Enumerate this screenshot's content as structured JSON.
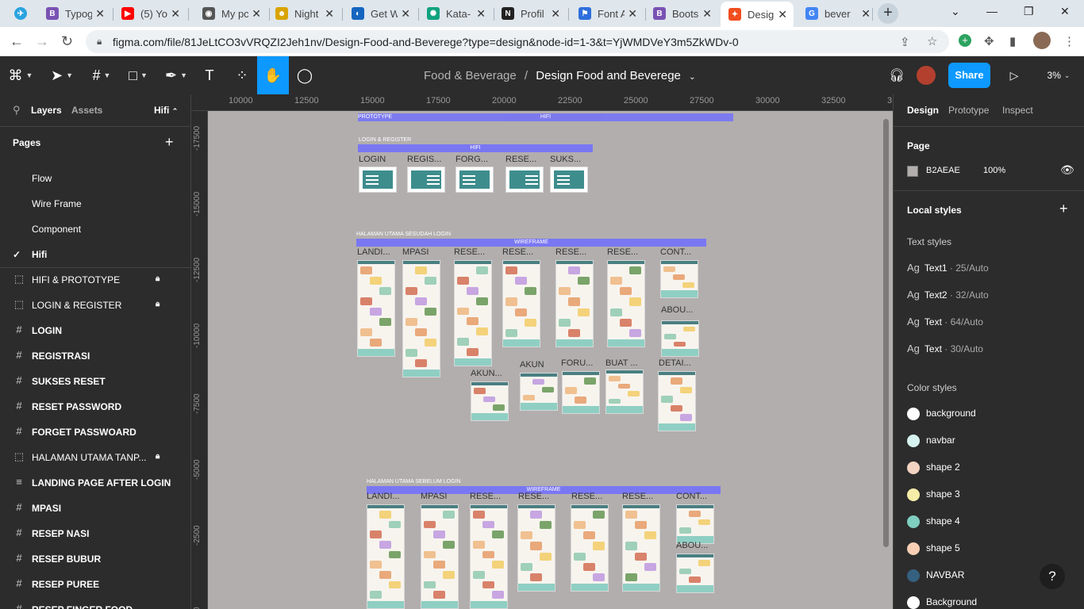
{
  "browser": {
    "tabs": [
      {
        "label": "Typog",
        "icon": "bootstrap-icon",
        "color": "#7952b3"
      },
      {
        "label": "(5) Yo",
        "icon": "youtube-icon",
        "color": "#ff0000"
      },
      {
        "label": "My pc",
        "icon": "globe-icon",
        "color": "#555555"
      },
      {
        "label": "Night",
        "icon": "mask-icon",
        "color": "#d9a400"
      },
      {
        "label": "Get W",
        "icon": "edge-icon",
        "color": "#1565c0"
      },
      {
        "label": "Kata-",
        "icon": "chatgpt-icon",
        "color": "#10a37f"
      },
      {
        "label": "Profil",
        "icon": "notion-icon",
        "color": "#222222"
      },
      {
        "label": "Font A",
        "icon": "flag-icon",
        "color": "#2f6fdd"
      },
      {
        "label": "Boots",
        "icon": "bootstrap-icon",
        "color": "#7952b3"
      },
      {
        "label": "Desig",
        "icon": "figma-icon",
        "color": "#f24e1e"
      },
      {
        "label": "bever",
        "icon": "google-icon",
        "color": "#4285f4"
      }
    ],
    "url": "figma.com/file/81JeLtCO3vVRQZI2Jeh1nv/Design-Food-and-Beverege?type=design&node-id=1-3&t=YjWMDVeY3m5ZkWDv-0"
  },
  "figma": {
    "project": "Food & Beverage",
    "separator": "/",
    "file": "Design Food and Beverege",
    "share": "Share",
    "zoom": "3%"
  },
  "left": {
    "tab_layers": "Layers",
    "tab_assets": "Assets",
    "page_switch": "Hifi",
    "pages_heading": "Pages",
    "pages": [
      "Flow",
      "Wire Frame",
      "Component",
      "Hifi"
    ],
    "current_page_check": "✓",
    "layers": [
      {
        "label": "HIFI & PROTOTYPE",
        "icon": "section-icon",
        "locked": true
      },
      {
        "label": "LOGIN & REGISTER",
        "icon": "section-icon",
        "locked": true
      },
      {
        "label": "LOGIN",
        "icon": "frame-icon",
        "locked": false
      },
      {
        "label": "REGISTRASI",
        "icon": "frame-icon",
        "locked": false
      },
      {
        "label": "SUKSES RESET",
        "icon": "frame-icon",
        "locked": false
      },
      {
        "label": "RESET PASSWORD",
        "icon": "frame-icon",
        "locked": false
      },
      {
        "label": "FORGET PASSWOARD",
        "icon": "frame-icon",
        "locked": false
      },
      {
        "label": "HALAMAN UTAMA TANP...",
        "icon": "section-icon",
        "locked": true
      },
      {
        "label": "LANDING PAGE AFTER LOGIN",
        "icon": "autolayout-icon",
        "locked": false
      },
      {
        "label": "MPASI",
        "icon": "frame-icon",
        "locked": false
      },
      {
        "label": "RESEP NASI",
        "icon": "frame-icon",
        "locked": false
      },
      {
        "label": "RESEP BUBUR",
        "icon": "frame-icon",
        "locked": false
      },
      {
        "label": "RESEP PUREE",
        "icon": "frame-icon",
        "locked": false
      },
      {
        "label": "RESEP FINGER FOOD",
        "icon": "frame-icon",
        "locked": false
      }
    ]
  },
  "rulers": {
    "top": [
      "10000",
      "12500",
      "15000",
      "17500",
      "20000",
      "22500",
      "25000",
      "27500",
      "30000",
      "32500",
      "3"
    ],
    "left": [
      "-17500",
      "-15000",
      "-12500",
      "-10000",
      "-7500",
      "-5000",
      "-2500",
      "0"
    ]
  },
  "canvas": {
    "bg": "#B2AEAE",
    "top_section": "PROTOTYPE",
    "top_bar": "HIFI",
    "login_section": "LOGIN & REGISTER",
    "login_bar": "HIFI",
    "login_frames": [
      "LOGIN",
      "REGIS...",
      "FORG...",
      "RESE...",
      "SUKS..."
    ],
    "after_section": "HALAMAN UTAMA SESUDAH LOGIN",
    "after_bar": "WIREFRAME",
    "after_frames_row1": [
      "LANDI...",
      "MPASI",
      "RESE...",
      "RESE...",
      "RESE...",
      "RESE...",
      "CONT..."
    ],
    "after_frames_row2": [
      "AKUN...",
      "AKUN",
      "FORU...",
      "BUAT ...",
      "DETAI...",
      "ABOU..."
    ],
    "before_section": "HALAMAN UTAMA SEBELUM LOGIN",
    "before_bar": "WIREFRAME",
    "before_frames": [
      "LANDI...",
      "MPASI",
      "RESE...",
      "RESE...",
      "RESE...",
      "RESE...",
      "CONT...",
      "ABOU..."
    ]
  },
  "right": {
    "tab_design": "Design",
    "tab_prototype": "Prototype",
    "tab_inspect": "Inspect",
    "page_heading": "Page",
    "page_color": "B2AEAE",
    "page_opacity": "100%",
    "local_styles": "Local styles",
    "text_styles_heading": "Text styles",
    "text_styles": [
      {
        "name": "Text1",
        "meta": " · 25/Auto"
      },
      {
        "name": "Text2",
        "meta": " · 32/Auto"
      },
      {
        "name": "Text",
        "meta": " · 64/Auto"
      },
      {
        "name": "Text",
        "meta": " · 30/Auto"
      }
    ],
    "color_styles_heading": "Color styles",
    "color_styles": [
      {
        "name": "background",
        "color": "#FFFFFF"
      },
      {
        "name": "navbar",
        "color": "#D6F3EF"
      },
      {
        "name": "shape 2",
        "color": "#F3D3C2"
      },
      {
        "name": "shape 3",
        "color": "#F6EDA8"
      },
      {
        "name": "shape 4",
        "color": "#7FCFC0"
      },
      {
        "name": "shape 5",
        "color": "#F8CFB4"
      },
      {
        "name": "NAVBAR",
        "color": "#35607F"
      },
      {
        "name": "Background",
        "color": "#FFFFFF"
      }
    ],
    "help": "?"
  }
}
